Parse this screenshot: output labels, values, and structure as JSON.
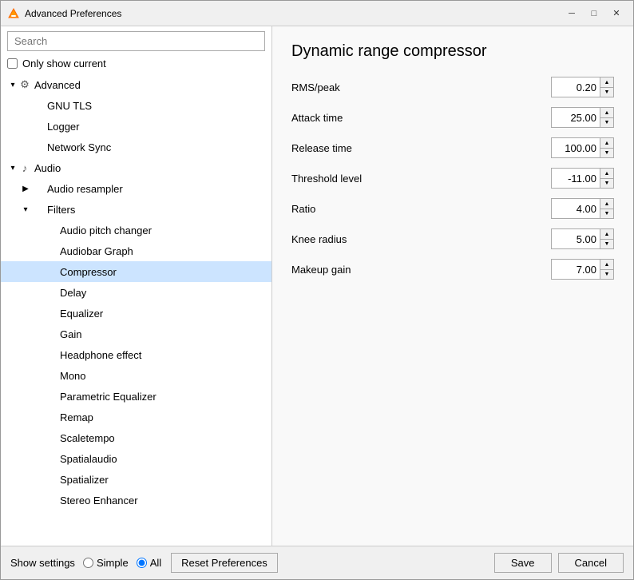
{
  "window": {
    "title": "Advanced Preferences",
    "icon": "vlc-icon"
  },
  "titlebar": {
    "minimize_label": "─",
    "maximize_label": "□",
    "close_label": "✕"
  },
  "left": {
    "search_placeholder": "Search",
    "only_show_current_label": "Only show current",
    "tree": [
      {
        "id": "advanced",
        "label": "Advanced",
        "level": 0,
        "arrow": "▾",
        "hasIcon": true,
        "iconType": "gear"
      },
      {
        "id": "gnu-tls",
        "label": "GNU TLS",
        "level": 1,
        "arrow": "",
        "hasIcon": false
      },
      {
        "id": "logger",
        "label": "Logger",
        "level": 1,
        "arrow": "",
        "hasIcon": false
      },
      {
        "id": "network-sync",
        "label": "Network Sync",
        "level": 1,
        "arrow": "",
        "hasIcon": false
      },
      {
        "id": "audio",
        "label": "Audio",
        "level": 0,
        "arrow": "▾",
        "hasIcon": true,
        "iconType": "audio"
      },
      {
        "id": "audio-resampler",
        "label": "Audio resampler",
        "level": 1,
        "arrow": "▶",
        "hasIcon": false
      },
      {
        "id": "filters",
        "label": "Filters",
        "level": 1,
        "arrow": "▾",
        "hasIcon": false
      },
      {
        "id": "audio-pitch-changer",
        "label": "Audio pitch changer",
        "level": 2,
        "arrow": "",
        "hasIcon": false
      },
      {
        "id": "audiobar-graph",
        "label": "Audiobar Graph",
        "level": 2,
        "arrow": "",
        "hasIcon": false
      },
      {
        "id": "compressor",
        "label": "Compressor",
        "level": 2,
        "arrow": "",
        "hasIcon": false,
        "selected": true
      },
      {
        "id": "delay",
        "label": "Delay",
        "level": 2,
        "arrow": "",
        "hasIcon": false
      },
      {
        "id": "equalizer",
        "label": "Equalizer",
        "level": 2,
        "arrow": "",
        "hasIcon": false
      },
      {
        "id": "gain",
        "label": "Gain",
        "level": 2,
        "arrow": "",
        "hasIcon": false
      },
      {
        "id": "headphone-effect",
        "label": "Headphone effect",
        "level": 2,
        "arrow": "",
        "hasIcon": false
      },
      {
        "id": "mono",
        "label": "Mono",
        "level": 2,
        "arrow": "",
        "hasIcon": false
      },
      {
        "id": "parametric-equalizer",
        "label": "Parametric Equalizer",
        "level": 2,
        "arrow": "",
        "hasIcon": false
      },
      {
        "id": "remap",
        "label": "Remap",
        "level": 2,
        "arrow": "",
        "hasIcon": false
      },
      {
        "id": "scaletempo",
        "label": "Scaletempo",
        "level": 2,
        "arrow": "",
        "hasIcon": false
      },
      {
        "id": "spatialaudio",
        "label": "Spatialaudio",
        "level": 2,
        "arrow": "",
        "hasIcon": false
      },
      {
        "id": "spatializer",
        "label": "Spatializer",
        "level": 2,
        "arrow": "",
        "hasIcon": false
      },
      {
        "id": "stereo-enhancer",
        "label": "Stereo Enhancer",
        "level": 2,
        "arrow": "",
        "hasIcon": false
      }
    ]
  },
  "right": {
    "title": "Dynamic range compressor",
    "params": [
      {
        "label": "RMS/peak",
        "value": "0.20"
      },
      {
        "label": "Attack time",
        "value": "25.00"
      },
      {
        "label": "Release time",
        "value": "100.00"
      },
      {
        "label": "Threshold level",
        "value": "-11.00"
      },
      {
        "label": "Ratio",
        "value": "4.00"
      },
      {
        "label": "Knee radius",
        "value": "5.00"
      },
      {
        "label": "Makeup gain",
        "value": "7.00"
      }
    ]
  },
  "bottom": {
    "show_settings_label": "Show settings",
    "simple_label": "Simple",
    "all_label": "All",
    "reset_label": "Reset Preferences",
    "save_label": "Save",
    "cancel_label": "Cancel"
  }
}
